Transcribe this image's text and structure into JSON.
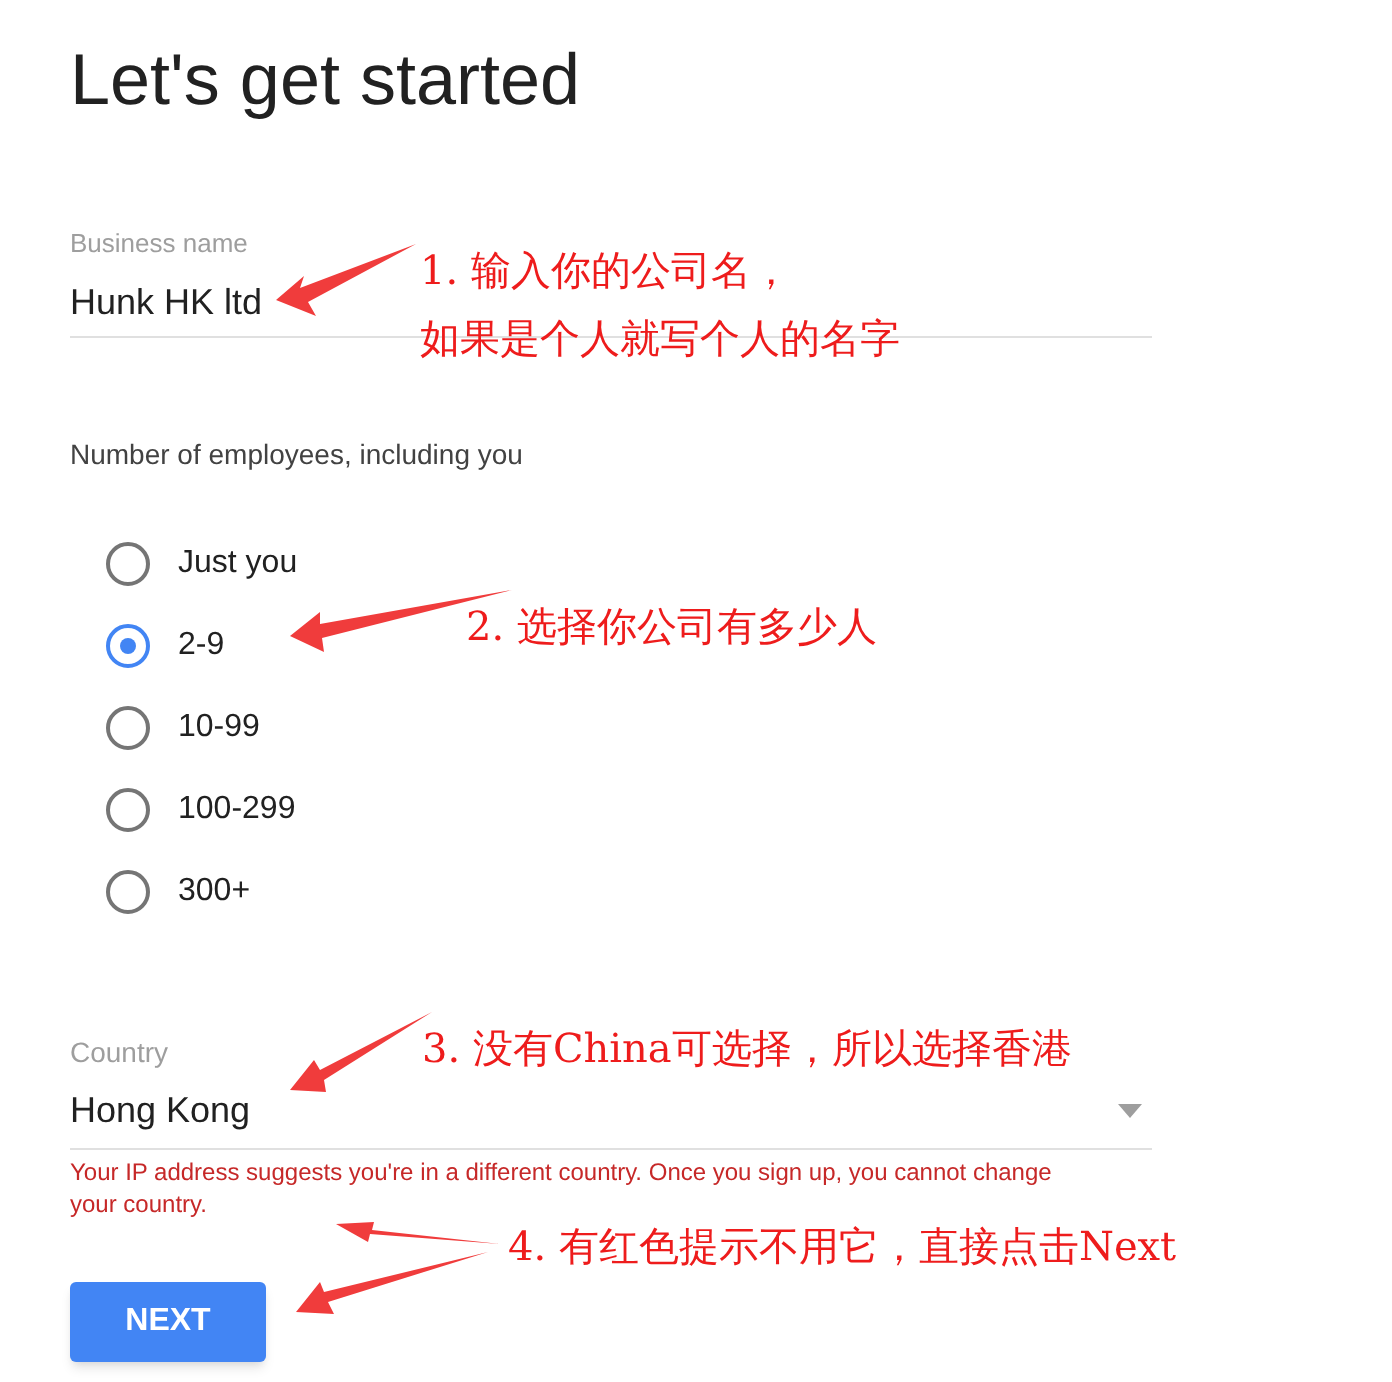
{
  "title": "Let's get started",
  "business_name": {
    "label": "Business name",
    "value": "Hunk HK ltd"
  },
  "employees": {
    "label": "Number of employees, including you",
    "options": [
      {
        "label": "Just you",
        "selected": false
      },
      {
        "label": "2-9",
        "selected": true
      },
      {
        "label": "10-99",
        "selected": false
      },
      {
        "label": "100-299",
        "selected": false
      },
      {
        "label": "300+",
        "selected": false
      }
    ]
  },
  "country": {
    "label": "Country",
    "value": "Hong Kong",
    "error": "Your IP address suggests you're in a different country. Once you sign up, you cannot change your country."
  },
  "next_button": "NEXT",
  "annotations": [
    {
      "lines": [
        "1. 输入你的公司名，",
        "如果是个人就写个人的名字"
      ]
    },
    {
      "lines": [
        "2. 选择你公司有多少人"
      ]
    },
    {
      "lines": [
        "3. 没有China可选择，所以选择香港"
      ]
    },
    {
      "lines": [
        "4. 有红色提示不用它，直接点击Next"
      ]
    }
  ]
}
